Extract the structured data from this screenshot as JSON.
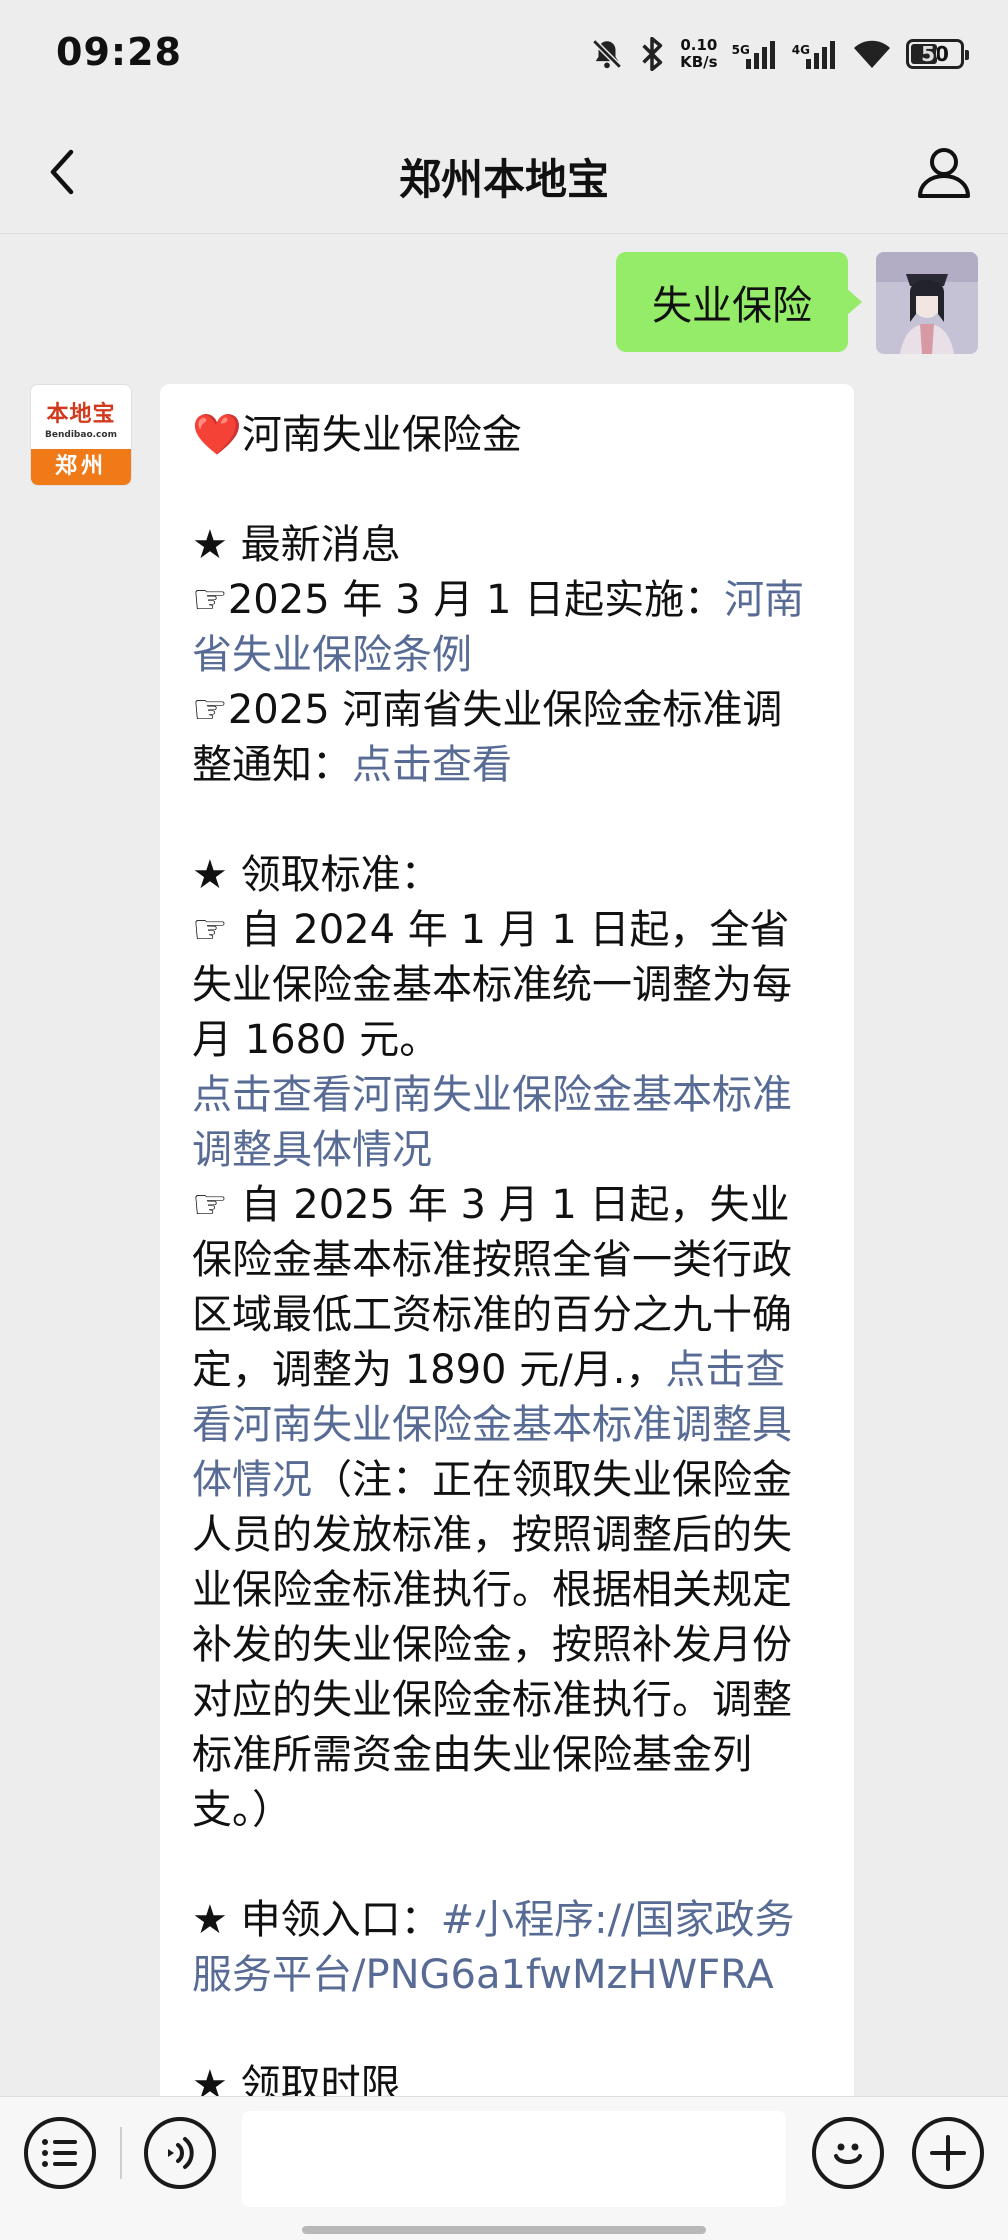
{
  "status_bar": {
    "time": "09:28",
    "net_speed_value": "0.10",
    "net_speed_unit": "KB/s",
    "signal1_label": "5G",
    "signal2_label": "4G",
    "battery_level": "50",
    "icons": [
      "mute-icon",
      "bluetooth-icon",
      "signal-icon",
      "signal-icon",
      "wifi-icon",
      "battery-icon"
    ]
  },
  "nav": {
    "title": "郑州本地宝",
    "back_icon": "chevron-left-icon",
    "profile_icon": "person-icon"
  },
  "messages": {
    "outgoing_text": "失业保险",
    "bot_avatar": {
      "logo_text": "本地宝",
      "logo_sub": "Bendibao.com",
      "city": "郑州"
    },
    "reply": {
      "heart": "❤️",
      "title": "河南失业保险金",
      "sec1_heading": "★ 最新消息",
      "item1_prefix": "☞2025 年 3 月 1 日起实施：",
      "item1_link": "河南省失业保险条例",
      "item2_prefix": "☞2025 河南省失业保险金标准调整通知：",
      "item2_link": "点击查看",
      "sec2_heading": "★ 领取标准：",
      "item3_text": "☞ 自 2024 年 1 月 1 日起，全省失业保险金基本标准统一调整为每月 1680 元。",
      "item3_link": "点击查看河南失业保险金基本标准调整具体情况",
      "item4_prefix": "☞ 自 2025 年 3 月 1 日起，失业保险金基本标准按照全省一类行政区域最低工资标准的百分之九十确定，调整为 1890 元/月.，",
      "item4_link": "点击查看河南失业保险金基本标准调整具体情况",
      "item4_suffix": "（注：正在领取失业保险金人员的发放标准，按照调整后的失业保险金标准执行。根据相关规定补发的失业保险金，按照补发月份对应的失业保险金标准执行。调整标准所需资金由失业保险基金列支。）",
      "sec3_label": "★ 申领入口：",
      "sec3_link": "#小程序://国家政务服务平台/PNG6a1fwMzHWFRA",
      "sec4_heading": "★ 领取时限"
    }
  },
  "input_bar": {
    "menu_icon": "list-menu-icon",
    "voice_icon": "voice-icon",
    "emoji_icon": "emoji-icon",
    "add_icon": "plus-icon",
    "placeholder": ""
  }
}
